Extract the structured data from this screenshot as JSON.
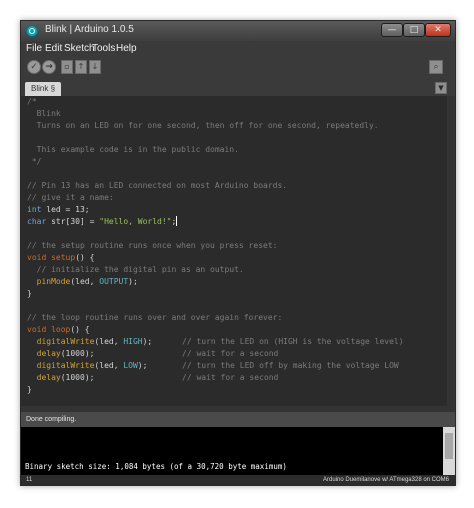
{
  "window": {
    "title": "Blink | Arduino 1.0.5",
    "controls": {
      "minimize": "—",
      "maximize": "□",
      "close": "✕"
    }
  },
  "menu": {
    "file": "File",
    "edit": "Edit",
    "sketch": "Sketch",
    "tools": "Tools",
    "help": "Help"
  },
  "toolbar": {
    "icons": [
      "verify-icon",
      "upload-icon",
      "new-icon",
      "open-icon",
      "save-icon",
      "serial-monitor-icon"
    ],
    "glyphs": {
      "verify": "✓",
      "upload": "→",
      "new": "▫",
      "open": "↑",
      "save": "↓",
      "serial": "⌕",
      "tab_menu": "▼"
    }
  },
  "tab": {
    "label": "Blink §"
  },
  "code": {
    "l1": "/*",
    "l2": "  Blink",
    "l3": "  Turns on an LED on for one second, then off for one second, repeatedly.",
    "l4": "",
    "l5": "  This example code is in the public domain.",
    "l6": " */",
    "l7": "",
    "l8": "// Pin 13 has an LED connected on most Arduino boards.",
    "l9": "// give it a name:",
    "l10": {
      "type": "int",
      "rest": " led = 13;"
    },
    "l11": {
      "type": "char",
      "rest": " str[30] = ",
      "string": "\"Hello, World!\"",
      "end": ";"
    },
    "l12": "",
    "l13": "// the setup routine runs once when you press reset:",
    "l14": {
      "type": "void",
      "fn": "setup",
      "rest": "() {"
    },
    "l15": "  // initialize the digital pin as an output.",
    "l16": {
      "fn": "pinMode",
      "args": "(led, ",
      "const": "OUTPUT",
      "end": ");"
    },
    "l17": "}",
    "l18": "",
    "l19": "// the loop routine runs over and over again forever:",
    "l20": {
      "type": "void",
      "fn": "loop",
      "rest": "() {"
    },
    "l21": {
      "fn": "digitalWrite",
      "args": "(led, ",
      "const": "HIGH",
      "end": ");",
      "comment": "// turn the LED on (HIGH is the voltage level)"
    },
    "l22": {
      "fn": "delay",
      "args": "(1000);",
      "comment": "// wait for a second"
    },
    "l23": {
      "fn": "digitalWrite",
      "args": "(led, ",
      "const": "LOW",
      "end": ");",
      "comment": "// turn the LED off by making the voltage LOW"
    },
    "l24": {
      "fn": "delay",
      "args": "(1000);",
      "comment": "// wait for a second"
    },
    "l25": "}"
  },
  "status": {
    "message": "Done compiling."
  },
  "console": {
    "output": "Binary sketch size: 1,084 bytes (of a 30,720 byte maximum)"
  },
  "footer": {
    "line": "11",
    "board": "Arduino Duemilanove w/ ATmega328 on COM6"
  },
  "colors": {
    "background": "#2b2b2b",
    "comment": "#7b7b7b",
    "keyword": "#cc6a2d",
    "type": "#6fa4d8",
    "function": "#d3a22f",
    "string": "#9ac05a",
    "constant": "#5fb7c4",
    "console_bg": "#000000"
  }
}
